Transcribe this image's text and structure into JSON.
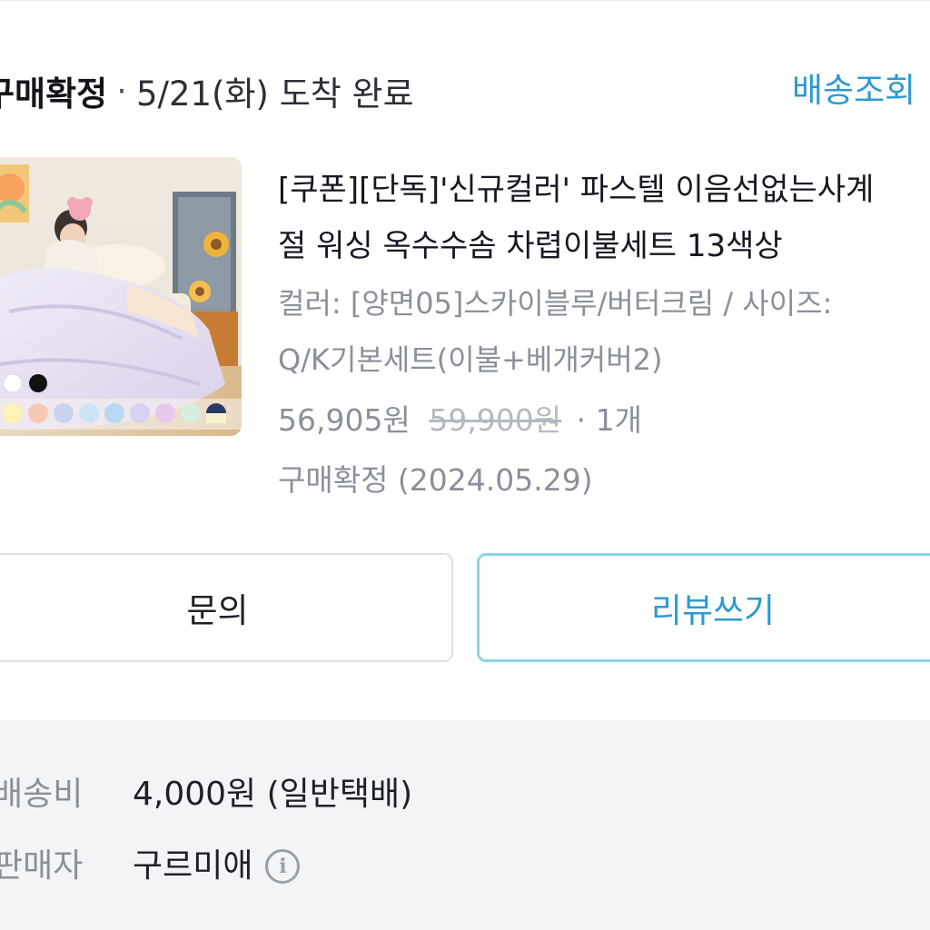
{
  "order_status": {
    "label": "구매확정",
    "separator": "·",
    "detail": "5/21(화) 도착 완료",
    "track_link": "배송조회"
  },
  "product": {
    "title_line1": "[쿠폰][단독]'신규컬러' 파스텔 이음선없는사계",
    "title_line2": "절 워싱 옥수수솜 차렵이불세트 13색상",
    "option_line1": "컬러: [양면05]스카이블루/버터크림 / 사이즈:",
    "option_line2": "Q/K기본세트(이불+베개커버2)",
    "price": "56,905원",
    "original_price": "59,900원",
    "quantity": "· 1개",
    "confirm_text": "구매확정 (2024.05.29)",
    "thumbnail_icon": "product-photo-bedding"
  },
  "actions": {
    "inquiry_label": "문의",
    "review_label": "리뷰쓰기"
  },
  "info": {
    "shipping_label": "배송비",
    "shipping_value": "4,000원 (일반택배)",
    "seller_label": "판매자",
    "seller_value": "구르미애",
    "seller_info_icon": "info-circle-icon"
  },
  "colors": {
    "accent": "#2c9ad1",
    "review_border": "#8cd3ec",
    "muted_text": "#8a9099",
    "panel_bg": "#f3f4f6"
  }
}
